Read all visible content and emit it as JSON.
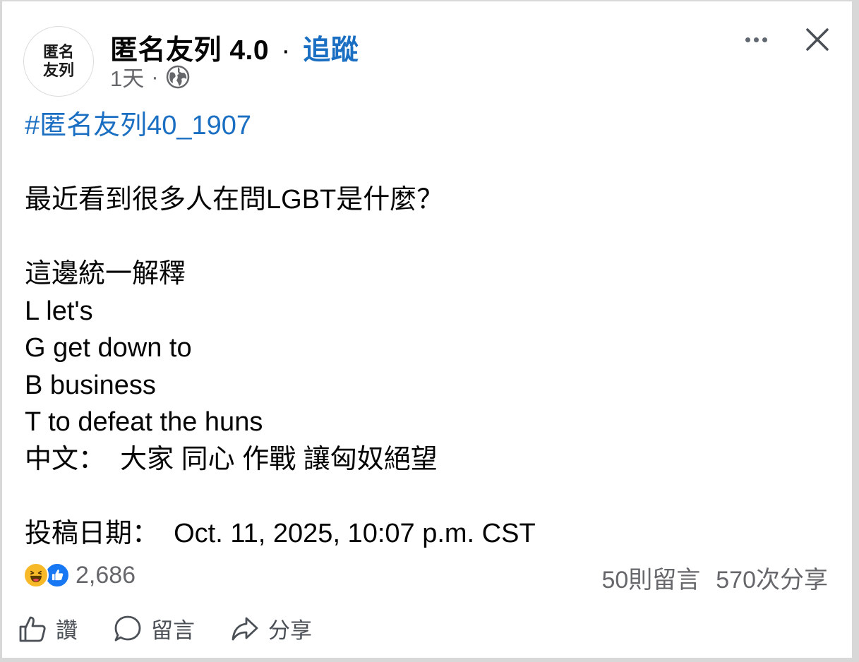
{
  "header": {
    "avatar_line1": "匿名",
    "avatar_line2": "友列",
    "page_name": "匿名友列 4.0",
    "separator": "·",
    "follow_label": "追蹤",
    "time": "1天",
    "meta_separator": "·",
    "privacy_icon": "globe-icon"
  },
  "controls": {
    "more_icon": "more-options-icon",
    "close_icon": "close-icon"
  },
  "post": {
    "hashtag": "#匿名友列40_1907",
    "lines": [
      "最近看到很多人在問LGBT是什麼？",
      "這邊統一解釋",
      "L let's",
      "G get down to",
      "B business",
      "T to defeat the huns",
      "中文：  大家 同心 作戰 讓匈奴絕望"
    ],
    "date_line": "投稿日期：  Oct. 11, 2025, 10:07 p.m. CST"
  },
  "reactions": {
    "icons": [
      "haha-reaction-icon",
      "like-reaction-icon"
    ],
    "count": "2,686"
  },
  "stats": {
    "comments": "50則留言",
    "shares": "570次分享"
  },
  "actions": {
    "like_label": "讚",
    "comment_label": "留言",
    "share_label": "分享"
  },
  "colors": {
    "link_blue": "#1b6fc2",
    "secondary_text": "#65676b",
    "like_blue": "#1877f2",
    "haha_yellow": "#f7b928"
  }
}
